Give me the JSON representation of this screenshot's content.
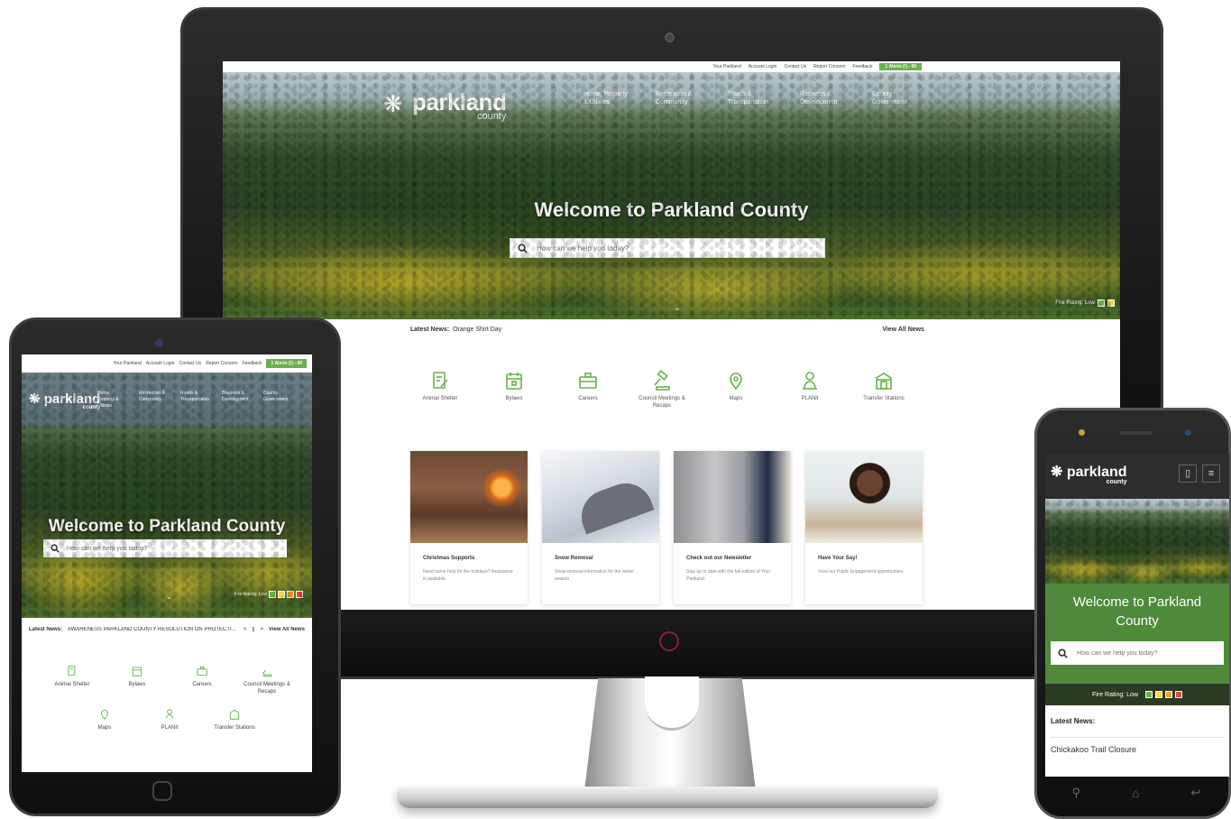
{
  "brand": {
    "name": "parkland",
    "sub": "county"
  },
  "colors": {
    "accent_green": "#6ab04c",
    "phone_green": "#4f8a3a",
    "fire_low": "#6ab04c",
    "fire_moderate": "#f2d64b",
    "fire_high": "#f0a030",
    "fire_extreme": "#e74c3c"
  },
  "desktop": {
    "topbar": [
      "Your Parkland",
      "Account Login",
      "Contact Us",
      "Report Concern",
      "Feedback"
    ],
    "alert": "1 Alerts (!) - 00",
    "nav": [
      "Home, Property & Utilities",
      "Recreation & Community",
      "Roads & Transportation",
      "Business & Development",
      "County Government"
    ],
    "hero_title": "Welcome to Parkland County",
    "search_placeholder": "How can we help you today?",
    "fire_label": "Fire Rating: Low",
    "news_label": "Latest News:",
    "news_item": "Orange Shirt Day",
    "view_all": "View All News",
    "quick_links": [
      {
        "label": "Animal Shelter",
        "icon": "document-pen-icon"
      },
      {
        "label": "Bylaws",
        "icon": "calendar-icon"
      },
      {
        "label": "Careers",
        "icon": "briefcase-icon"
      },
      {
        "label": "Council Meetings & Recaps",
        "icon": "gavel-icon"
      },
      {
        "label": "Maps",
        "icon": "map-pin-icon"
      },
      {
        "label": "PLANit",
        "icon": "person-pin-icon"
      },
      {
        "label": "Transfer Stations",
        "icon": "building-icon"
      }
    ],
    "cards": [
      {
        "title": "Christmas Supports",
        "desc": "Need some help for the holidays? Assistance is available."
      },
      {
        "title": "Snow Removal",
        "desc": "Snow removal information for the winter season."
      },
      {
        "title": "Check out our Newsletter",
        "desc": "Stay up to date with the fall edition of Your Parkland."
      },
      {
        "title": "Have Your Say!",
        "desc": "View our Public Engagement opportunities."
      }
    ]
  },
  "tablet": {
    "topbar": [
      "Your Parkland",
      "Account Login",
      "Contact Us",
      "Report Concern",
      "Feedback"
    ],
    "alert": "1 Alerts (!) - 00",
    "nav": [
      "Home, Property & Utilities",
      "Recreation & Community",
      "Roads & Transportation",
      "Business & Development",
      "County Government"
    ],
    "hero_title": "Welcome to Parkland County",
    "search_placeholder": "How can we help you today?",
    "fire_label": "Fire Rating: Low",
    "news_label": "Latest News:",
    "news_item": "AWARENESS PARKLAND COUNTY RESOLUTION ON PROTECTI...",
    "pager": [
      "<",
      "||",
      ">"
    ],
    "view_all": "View All News",
    "quick_links": [
      "Animal Shelter",
      "Bylaws",
      "Careers",
      "Council Meetings & Recaps",
      "Maps",
      "PLANit",
      "Transfer Stations"
    ]
  },
  "phone": {
    "hero_title": "Welcome to Parkland County",
    "search_placeholder": "How can we help you today?",
    "fire_label": "Fire Rating: Low",
    "news_label": "Latest News:",
    "news_item": "Chickakoo Trail Closure"
  }
}
